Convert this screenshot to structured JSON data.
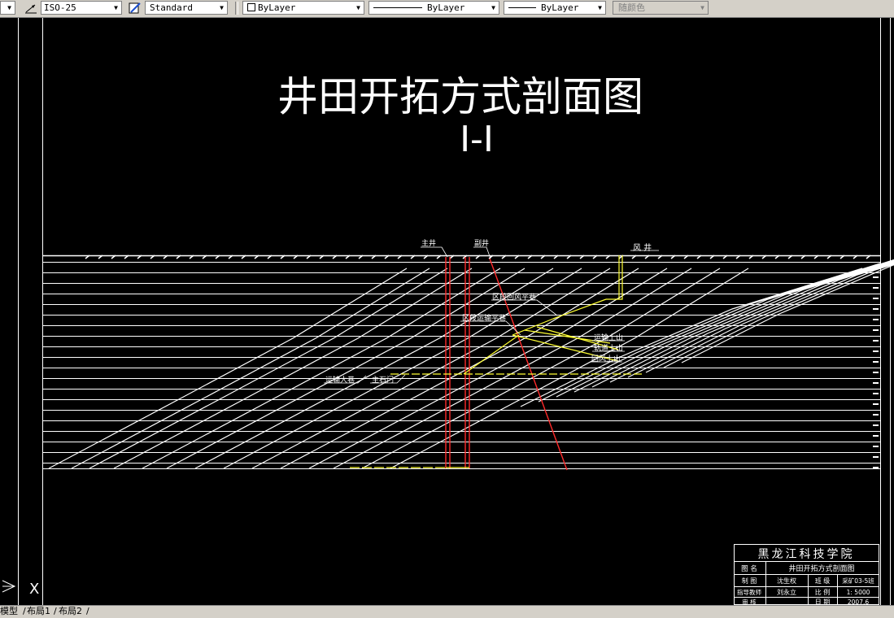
{
  "toolbar": {
    "dimstyle": "ISO-25",
    "textstyle": "Standard",
    "layer": "ByLayer",
    "linetype": "ByLayer",
    "lineweight": "ByLayer",
    "plotstyle": "随颜色"
  },
  "drawing": {
    "title": "井田开拓方式剖面图",
    "subtitle": "I-I",
    "labels": {
      "main_shaft": "主井",
      "aux_shaft": "副井",
      "vent_shaft": "风 井",
      "section_return_roadway": "区段回风平巷",
      "section_haulage_roadway": "区段运输平巷",
      "haulage_uphill": "运输上山",
      "track_uphill": "轨道上山",
      "return_uphill": "回风上山",
      "main_haulage_roadway": "运输大巷",
      "main_crosscut": "主石门"
    }
  },
  "title_block": {
    "school": "黑龙江科技学院",
    "rows": [
      {
        "k1": "图 名",
        "v1": "井田开拓方式剖面图",
        "k2": "",
        "v2": ""
      },
      {
        "k1": "制 图",
        "v1": "沈生权",
        "k2": "班 级",
        "v2": "采矿03-5班"
      },
      {
        "k1": "指导教师",
        "v1": "刘永立",
        "k2": "比 例",
        "v2": "1: 5000"
      },
      {
        "k1": "审 核",
        "v1": "",
        "k2": "日 期",
        "v2": "2007.6"
      }
    ]
  },
  "ucs": {
    "x_label": "X"
  },
  "tabs": [
    {
      "label": "模型",
      "active": true
    },
    {
      "label": "布局1",
      "active": false
    },
    {
      "label": "布局2",
      "active": false
    }
  ],
  "colors": {
    "background": "#000000",
    "strata": "#ffffff",
    "shaft": "#ff2a2a",
    "roadway": "#ffff33",
    "toolbar": "#d4d0c8"
  }
}
